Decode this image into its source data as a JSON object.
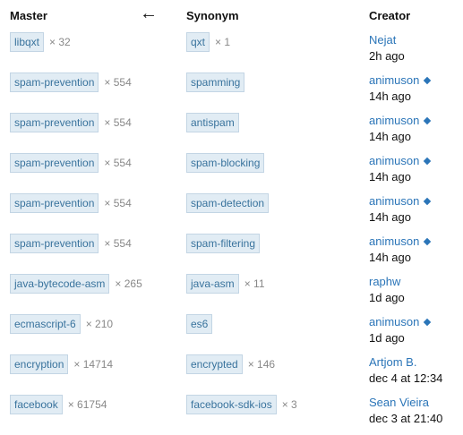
{
  "headers": {
    "master": "Master",
    "arrow": "←",
    "synonym": "Synonym",
    "creator": "Creator"
  },
  "rows": [
    {
      "master": "libqxt",
      "master_count": "× 32",
      "synonym": "qxt",
      "synonym_count": "× 1",
      "creator": "Nejat",
      "moderator": false,
      "time": "2h ago"
    },
    {
      "master": "spam-prevention",
      "master_count": "× 554",
      "synonym": "spamming",
      "synonym_count": "",
      "creator": "animuson",
      "moderator": true,
      "time": "14h ago"
    },
    {
      "master": "spam-prevention",
      "master_count": "× 554",
      "synonym": "antispam",
      "synonym_count": "",
      "creator": "animuson",
      "moderator": true,
      "time": "14h ago"
    },
    {
      "master": "spam-prevention",
      "master_count": "× 554",
      "synonym": "spam-blocking",
      "synonym_count": "",
      "creator": "animuson",
      "moderator": true,
      "time": "14h ago"
    },
    {
      "master": "spam-prevention",
      "master_count": "× 554",
      "synonym": "spam-detection",
      "synonym_count": "",
      "creator": "animuson",
      "moderator": true,
      "time": "14h ago"
    },
    {
      "master": "spam-prevention",
      "master_count": "× 554",
      "synonym": "spam-filtering",
      "synonym_count": "",
      "creator": "animuson",
      "moderator": true,
      "time": "14h ago"
    },
    {
      "master": "java-bytecode-asm",
      "master_count": "× 265",
      "synonym": "java-asm",
      "synonym_count": "× 11",
      "creator": "raphw",
      "moderator": false,
      "time": "1d ago"
    },
    {
      "master": "ecmascript-6",
      "master_count": "× 210",
      "synonym": "es6",
      "synonym_count": "",
      "creator": "animuson",
      "moderator": true,
      "time": "1d ago"
    },
    {
      "master": "encryption",
      "master_count": "× 14714",
      "synonym": "encrypted",
      "synonym_count": "× 146",
      "creator": "Artjom B.",
      "moderator": false,
      "time": "dec 4 at 12:34"
    },
    {
      "master": "facebook",
      "master_count": "× 61754",
      "synonym": "facebook-sdk-ios",
      "synonym_count": "× 3",
      "creator": "Sean Vieira",
      "moderator": false,
      "time": "dec 3 at 21:40"
    }
  ]
}
